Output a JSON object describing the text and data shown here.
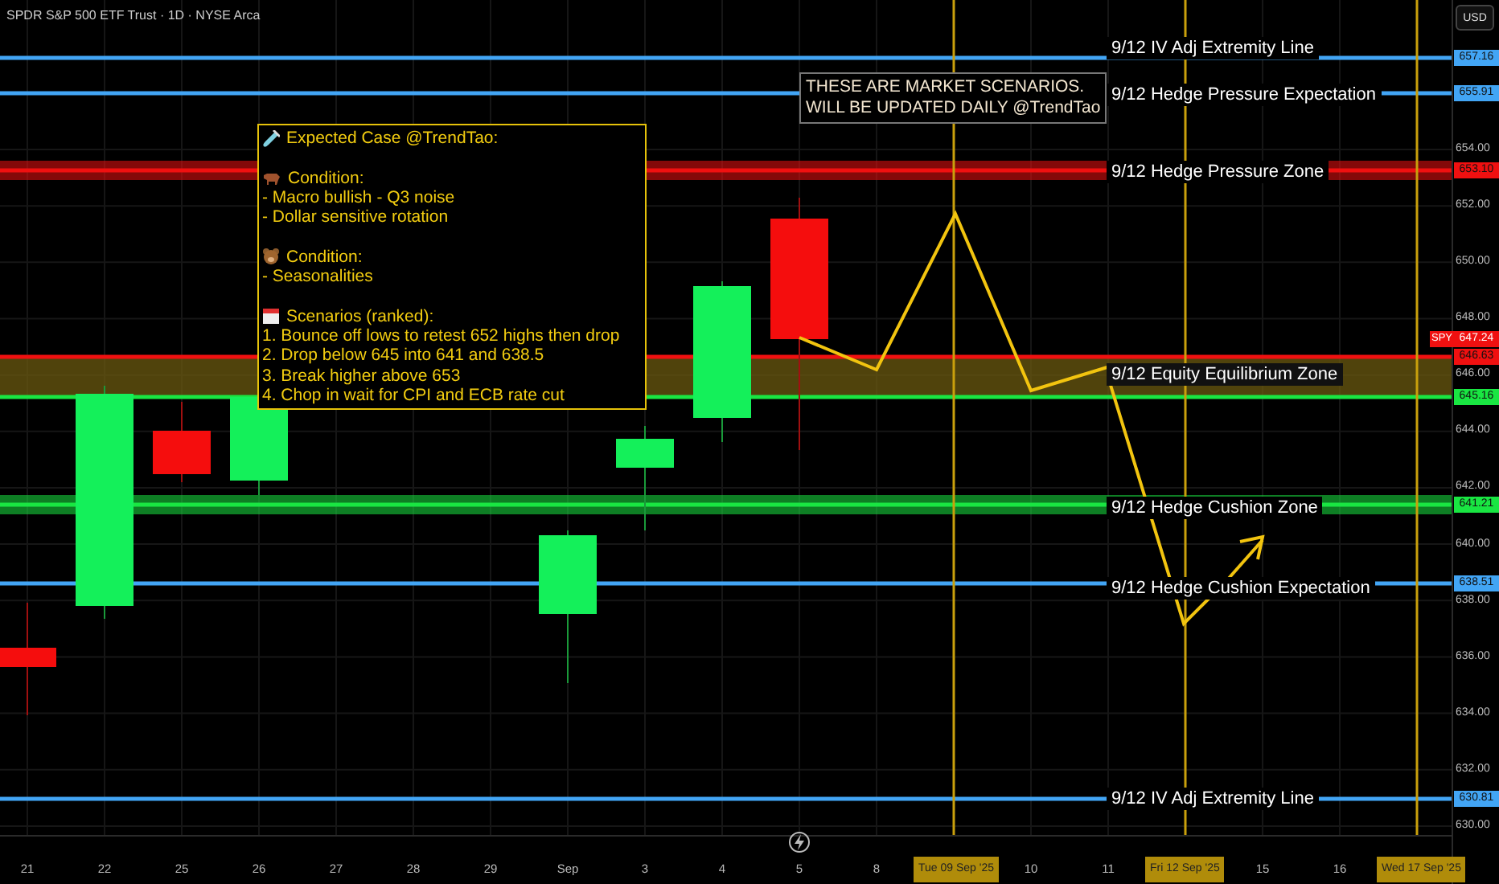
{
  "header": {
    "title": "SPDR S&P 500 ETF Trust · 1D · NYSE Arca"
  },
  "currency_button": "USD",
  "banner": {
    "lines": [
      "THESE ARE MARKET SCENARIOS.",
      "WILL BE UPDATED DAILY @TrendTao"
    ]
  },
  "note": {
    "title": "Expected Case @TrendTao:",
    "sections": [
      {
        "kind": "bull",
        "heading": "Condition:",
        "lines": [
          "- Macro bullish - Q3 noise",
          "- Dollar sensitive rotation"
        ]
      },
      {
        "kind": "bear",
        "heading": "Condition:",
        "lines": [
          "- Seasonalities"
        ]
      },
      {
        "kind": "calendar",
        "heading": "Scenarios (ranked):",
        "lines": [
          "1. Bounce off lows to retest 652 highs then drop",
          "2. Drop below 645 into 641 and 638.5",
          "3. Break higher above 653",
          "4. Chop in wait for CPI and ECB rate cut"
        ]
      }
    ]
  },
  "levels": [
    {
      "kind": "line",
      "label": "9/12 IV Adj Extremity Line",
      "price_tag": "657.16",
      "color": "#42a5f5"
    },
    {
      "kind": "line",
      "label": "9/12 Hedge Pressure Expectation",
      "price_tag": "655.91",
      "color": "#42a5f5"
    },
    {
      "kind": "zone",
      "label": "9/12 Hedge Pressure Zone",
      "price_tag": "653.10",
      "color": "#f01010"
    },
    {
      "kind": "band",
      "label": "9/12 Equity Equilibrium Zone",
      "price_tag": "646.63",
      "color": "#f01010"
    },
    {
      "kind": "line",
      "price_tag": "645.16",
      "color": "#19e642"
    },
    {
      "kind": "zone",
      "label": "9/12 Hedge Cushion Zone",
      "price_tag": "641.21",
      "color": "#19e642"
    },
    {
      "kind": "line",
      "label": "9/12 Hedge Cushion Expectation",
      "price_tag": "638.51",
      "color": "#42a5f5"
    },
    {
      "kind": "line",
      "label": "9/12 IV Adj Extremity Line",
      "price_tag": "630.81",
      "color": "#42a5f5"
    }
  ],
  "last_price": {
    "symbol": "SPY",
    "price": "647.24"
  },
  "price_axis": [
    "654.00",
    "652.00",
    "650.00",
    "648.00",
    "646.00",
    "644.00",
    "642.00",
    "640.00",
    "638.00",
    "636.00",
    "634.00",
    "632.00",
    "630.00"
  ],
  "date_axis": [
    {
      "label": "21",
      "highlighted": false
    },
    {
      "label": "22",
      "highlighted": false
    },
    {
      "label": "25",
      "highlighted": false
    },
    {
      "label": "26",
      "highlighted": false
    },
    {
      "label": "27",
      "highlighted": false
    },
    {
      "label": "28",
      "highlighted": false
    },
    {
      "label": "29",
      "highlighted": false
    },
    {
      "label": "Sep",
      "highlighted": false
    },
    {
      "label": "3",
      "highlighted": false
    },
    {
      "label": "4",
      "highlighted": false
    },
    {
      "label": "5",
      "highlighted": false
    },
    {
      "label": "8",
      "highlighted": false
    },
    {
      "label": "Tue 09 Sep '25",
      "highlighted": true
    },
    {
      "label": "10",
      "highlighted": false
    },
    {
      "label": "11",
      "highlighted": false
    },
    {
      "label": "Fri 12 Sep '25",
      "highlighted": true
    },
    {
      "label": "15",
      "highlighted": false
    },
    {
      "label": "16",
      "highlighted": false
    },
    {
      "label": "Wed 17 Sep '25",
      "highlighted": true
    }
  ]
}
